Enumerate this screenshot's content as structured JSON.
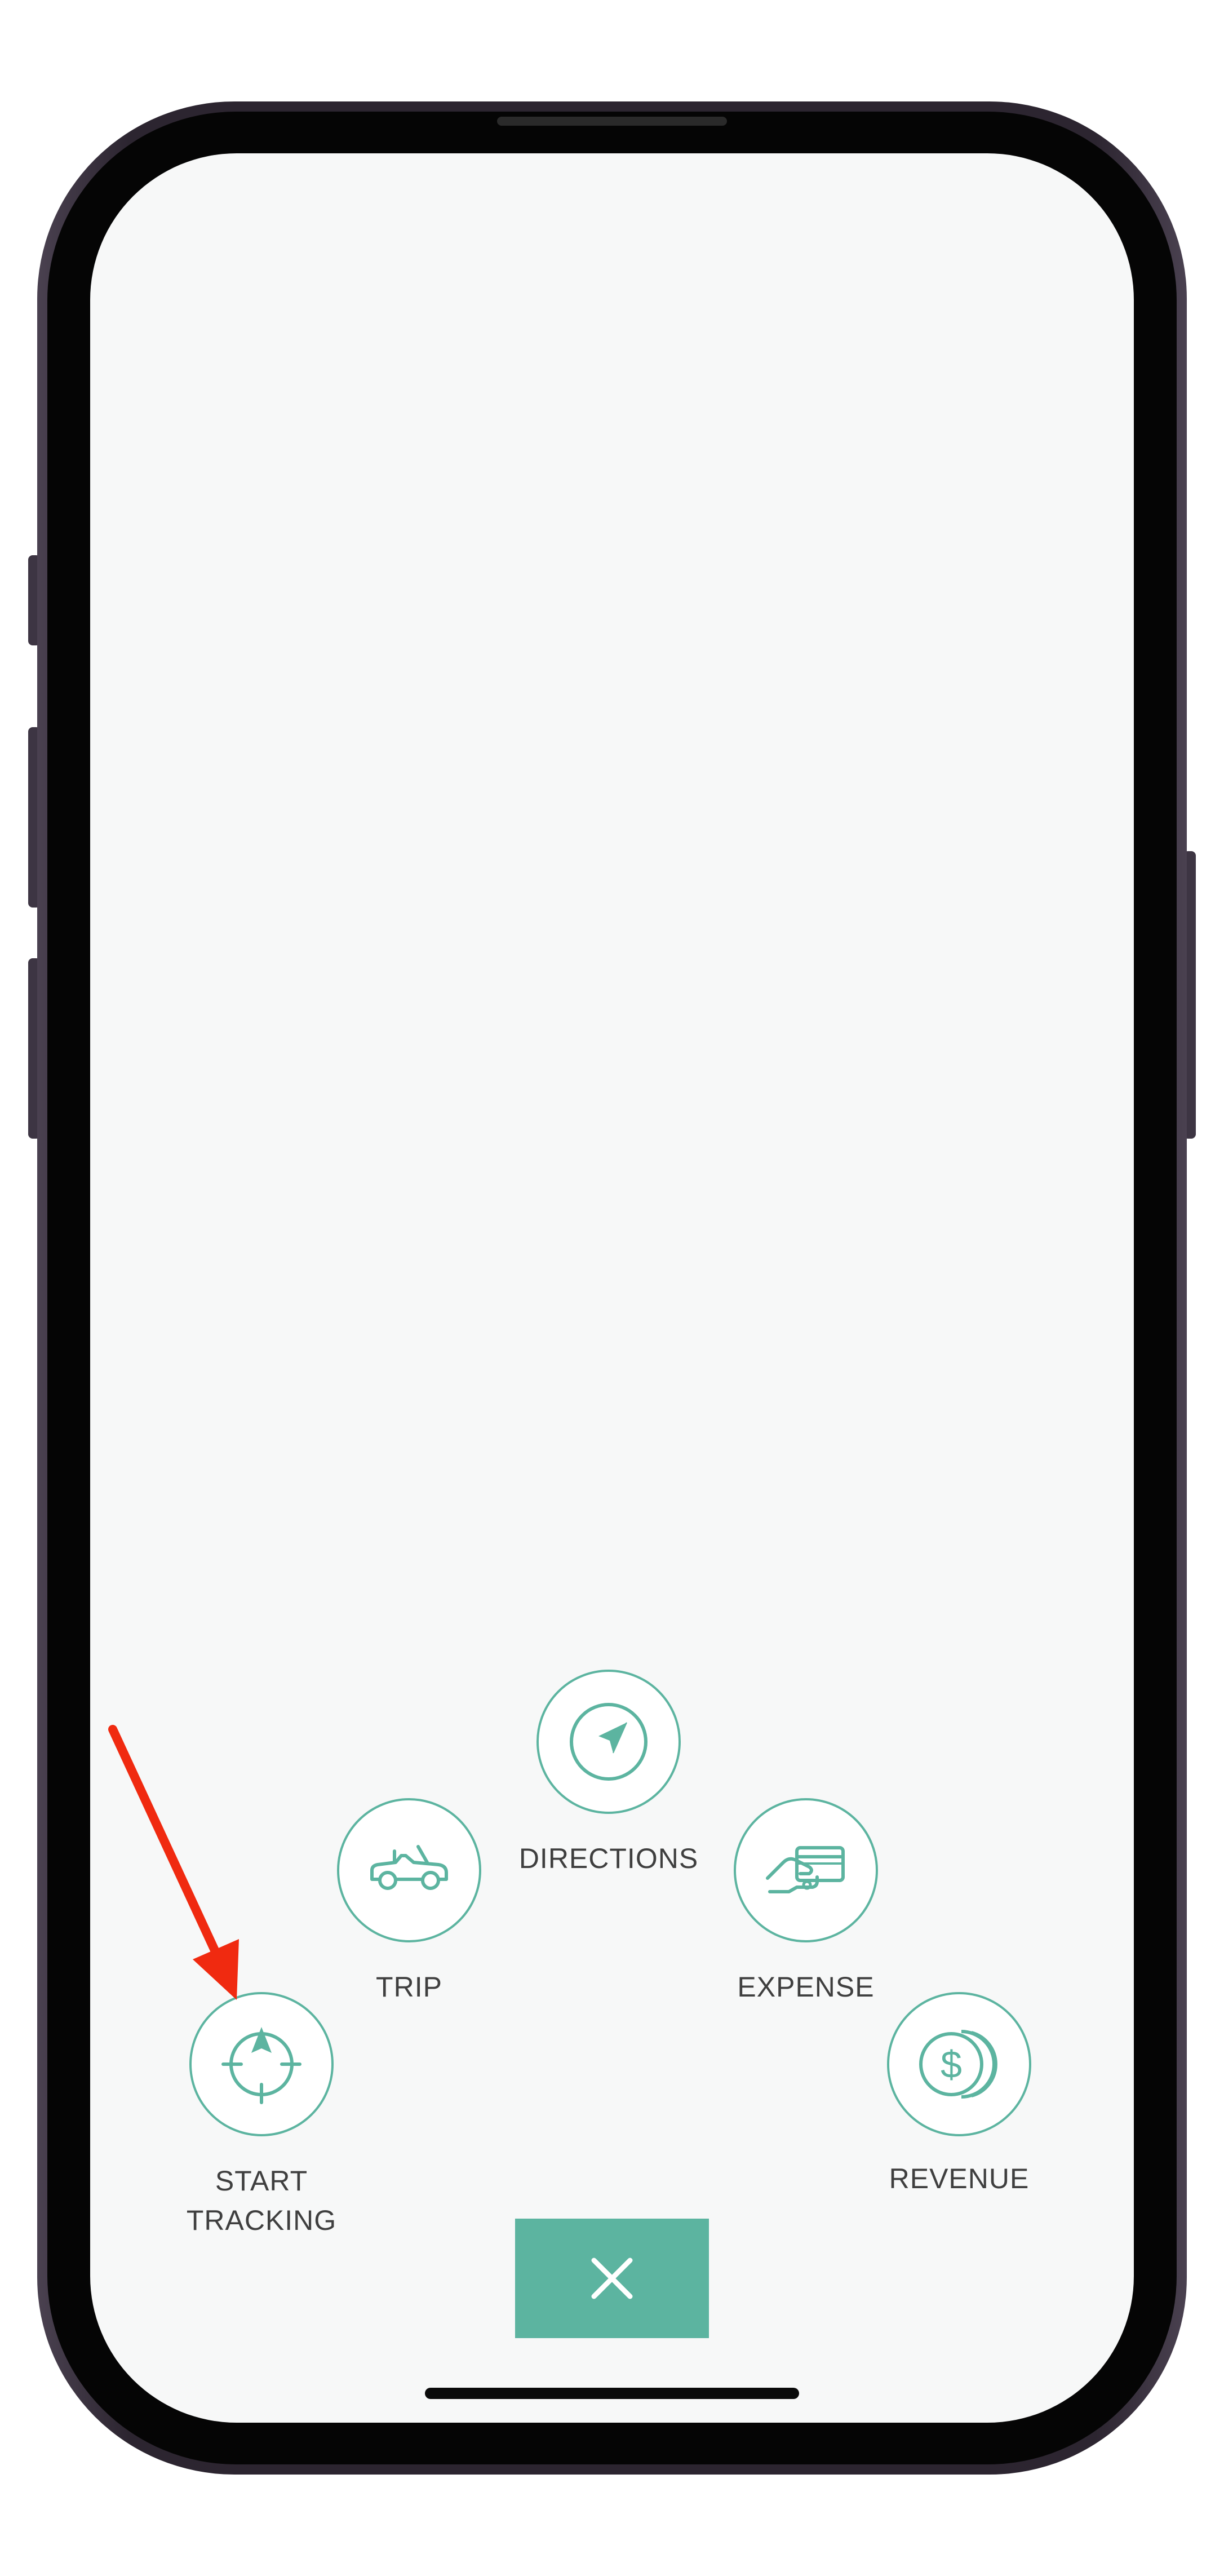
{
  "actions": {
    "directions": {
      "label": "DIRECTIONS",
      "icon": "navigation-arrow-icon"
    },
    "trip": {
      "label": "TRIP",
      "icon": "car-icon"
    },
    "expense": {
      "label": "EXPENSE",
      "icon": "card-in-hand-icon"
    },
    "start_tracking": {
      "label_line1": "START",
      "label_line2": "TRACKING",
      "icon": "crosshair-compass-icon"
    },
    "revenue": {
      "label": "REVENUE",
      "icon": "coins-icon"
    }
  },
  "close_button": {
    "icon": "close-icon"
  },
  "annotation": {
    "icon": "red-arrow-icon"
  },
  "colors": {
    "accent": "#5cb4a0",
    "label_text": "#3f3f3f",
    "screen_bg": "#f7f8f8",
    "annotation": "#f02a10"
  }
}
